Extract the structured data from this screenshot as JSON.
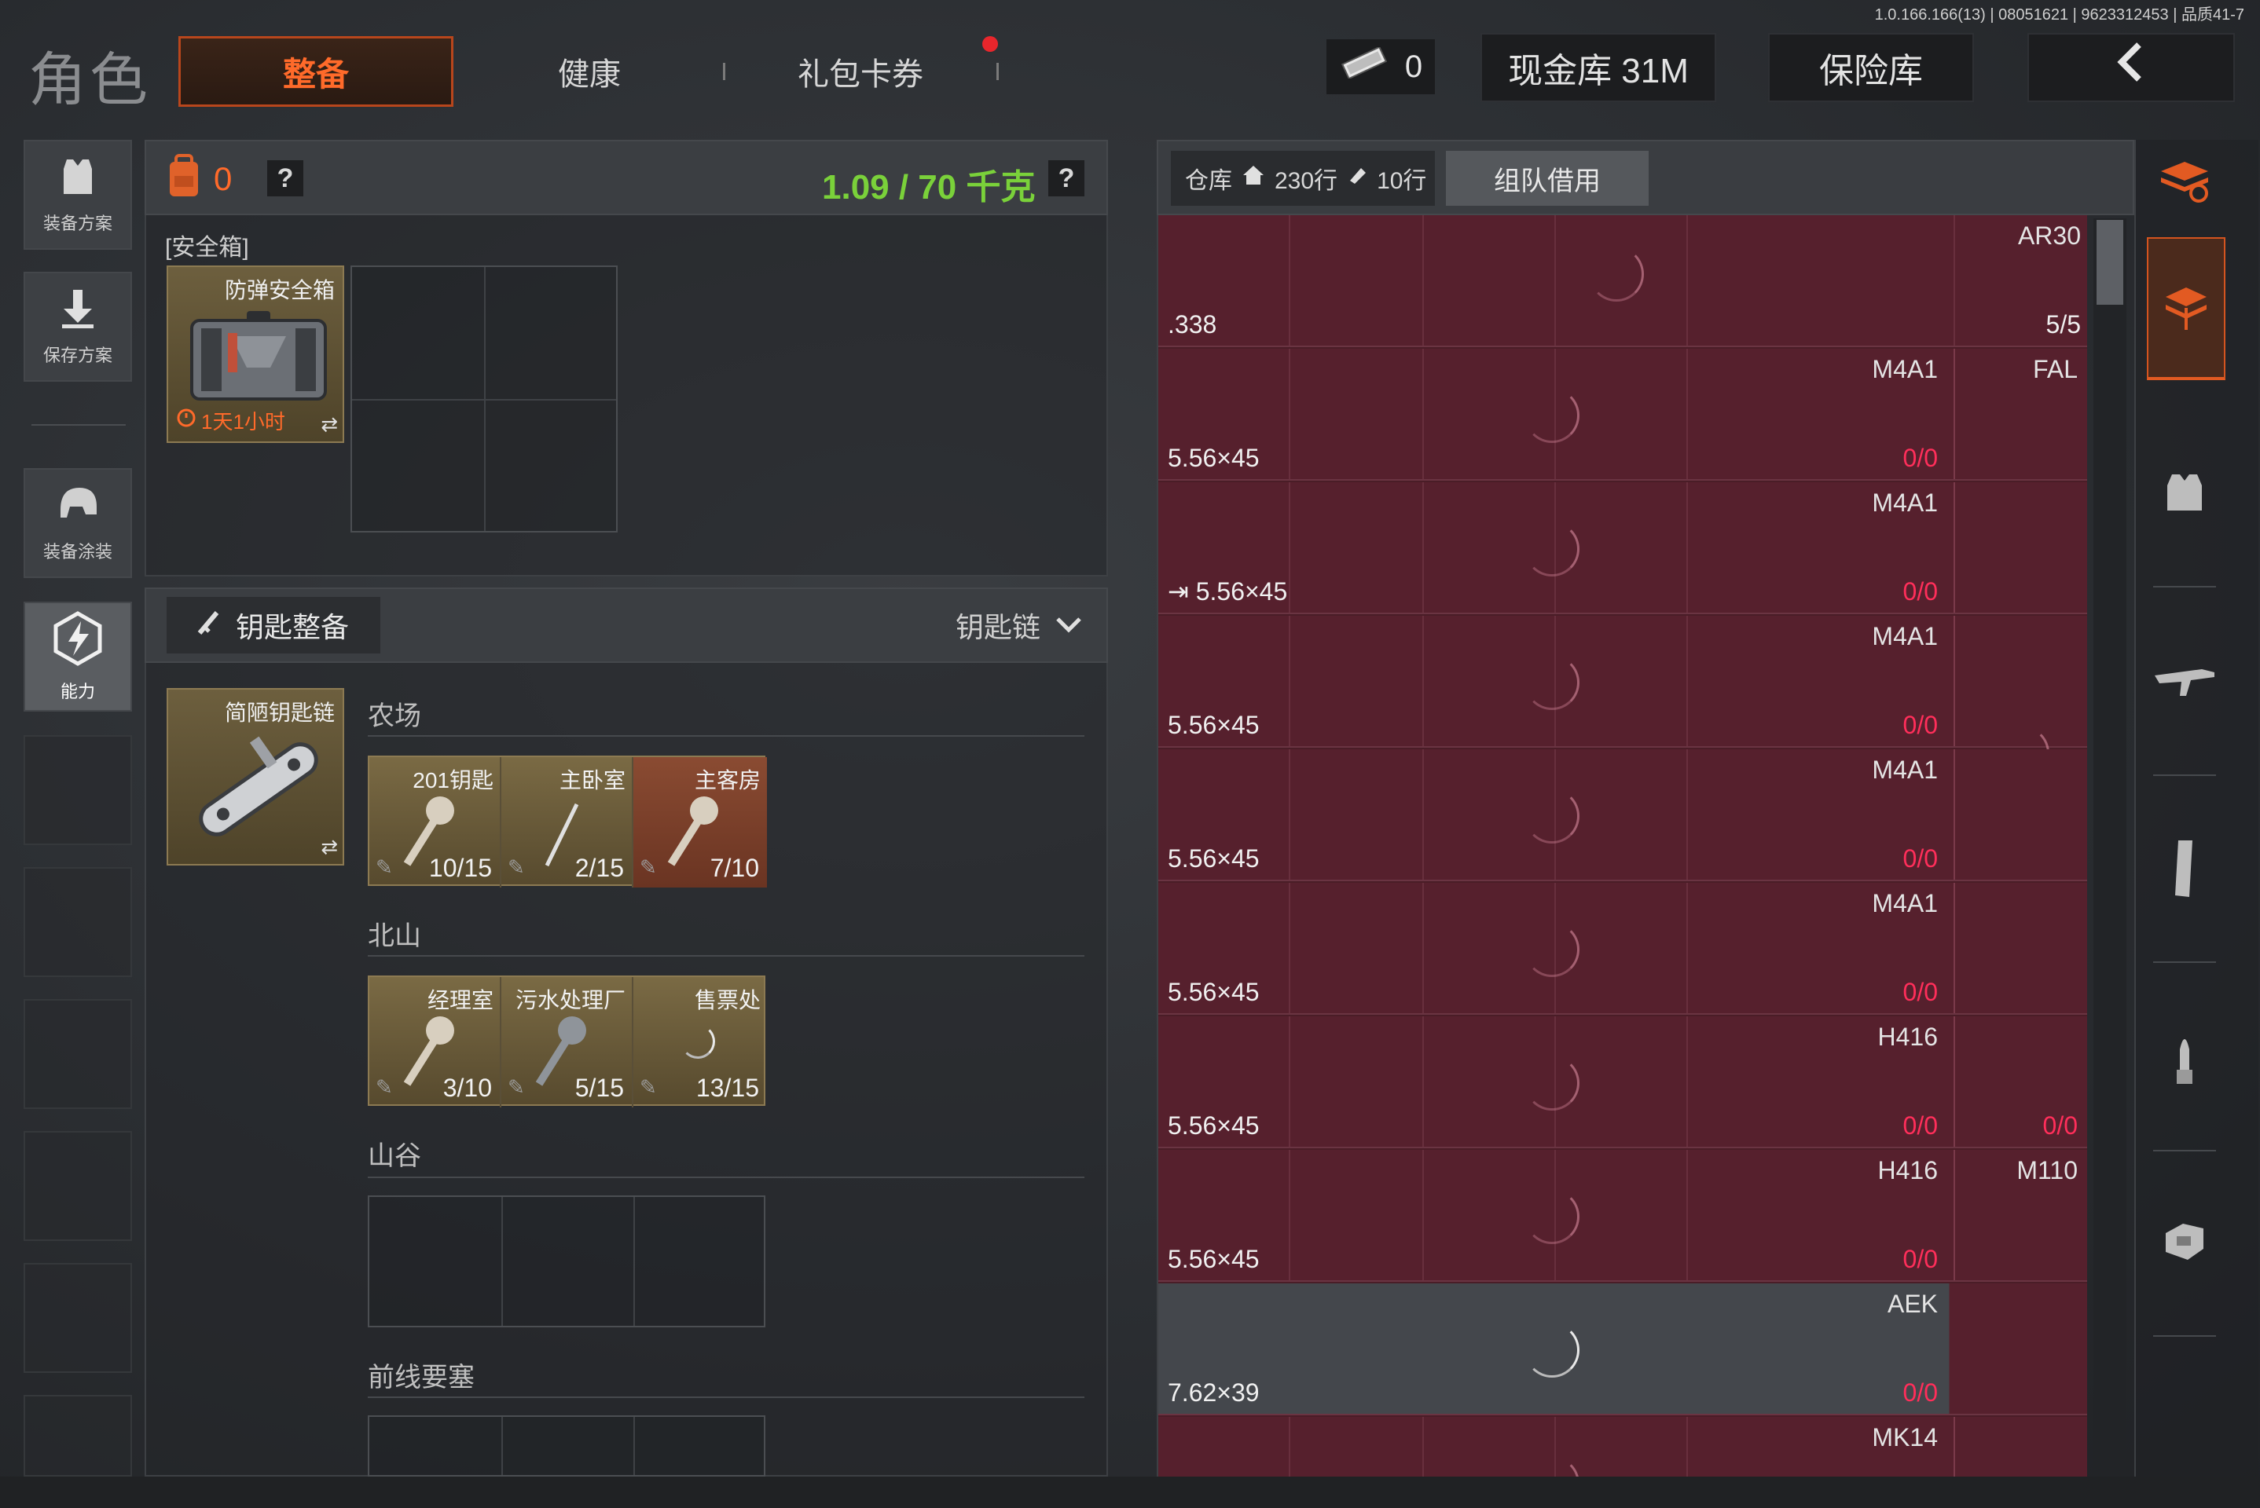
{
  "version": "1.0.166.166(13) | 08051621 | 9623312453 | 品质41-7",
  "header": {
    "title": "角色",
    "tabs": [
      {
        "label": "整备",
        "active": true
      },
      {
        "label": "健康",
        "active": false
      },
      {
        "label": "礼包卡券",
        "active": false
      }
    ],
    "money_value": "0",
    "cash_button": "现金库 31M",
    "safe_button": "保险库",
    "back_icon": "‹",
    "accent_color": "#ff6a2a"
  },
  "sidebar": {
    "items": [
      {
        "label": "装备方案",
        "icon": "armor-vest-icon"
      },
      {
        "label": "保存方案",
        "icon": "download-icon"
      },
      {
        "label": "装备涂装",
        "icon": "helmet-icon"
      },
      {
        "label": "能力",
        "icon": "ability-icon",
        "active": true
      }
    ]
  },
  "loadout": {
    "backpack_count": "0",
    "help": "?",
    "weight": "1.09 / 70 千克",
    "weight_color": "#7ad13a",
    "safe_box_label": "[安全箱]",
    "safe_box_item": {
      "name": "防弹安全箱",
      "timer": "1天1小时"
    }
  },
  "keys": {
    "title": "钥匙整备",
    "dropdown": "钥匙链",
    "keychain_item": "简陋钥匙链",
    "sections": [
      {
        "name": "农场",
        "keys": [
          {
            "name": "201钥匙",
            "count": "10/15"
          },
          {
            "name": "主卧室",
            "count": "2/15"
          },
          {
            "name": "主客房",
            "count": "7/10"
          }
        ]
      },
      {
        "name": "北山",
        "keys": [
          {
            "name": "经理室",
            "count": "3/10"
          },
          {
            "name": "污水处理厂",
            "count": "5/15"
          },
          {
            "name": "售票处",
            "count": "13/15"
          }
        ]
      },
      {
        "name": "山谷",
        "keys": []
      },
      {
        "name": "前线要塞",
        "keys": []
      }
    ]
  },
  "storage": {
    "warehouse_label": "仓库",
    "home_rows": "230行",
    "ticket_rows": "10行",
    "team_tab": "组队借用",
    "rows": [
      {
        "caliber": ".338",
        "name": "AR30",
        "ammo": "5/5",
        "right_name": "",
        "right_ammo": ""
      },
      {
        "caliber": "5.56×45",
        "name": "M4A1",
        "ammo": "0/0",
        "right_name": "FAL",
        "right_ammo": ""
      },
      {
        "caliber": "5.56×45",
        "name": "M4A1",
        "ammo": "0/0",
        "right_name": "",
        "right_ammo": ""
      },
      {
        "caliber": "5.56×45",
        "name": "M4A1",
        "ammo": "0/0",
        "right_name": "",
        "right_ammo": ""
      },
      {
        "caliber": "5.56×45",
        "name": "M4A1",
        "ammo": "0/0",
        "right_name": "",
        "right_ammo": ""
      },
      {
        "caliber": "5.56×45",
        "name": "M4A1",
        "ammo": "0/0",
        "right_name": "",
        "right_ammo": ""
      },
      {
        "caliber": "5.56×45",
        "name": "H416",
        "ammo": "0/0",
        "right_name": "",
        "right_ammo": "0/0"
      },
      {
        "caliber": "5.56×45",
        "name": "H416",
        "ammo": "0/0",
        "right_name": "M110",
        "right_ammo": ""
      },
      {
        "caliber": "7.62×39",
        "name": "AEK",
        "ammo": "0/0",
        "right_name": "",
        "right_ammo": ""
      },
      {
        "caliber": "",
        "name": "MK14",
        "ammo": "",
        "right_name": "",
        "right_ammo": ""
      }
    ],
    "ammo_zero_color": "#ff2e5a"
  },
  "filters": [
    "stack-refresh-icon",
    "inventory-icon",
    "armor-icon",
    "rifle-icon",
    "magazine-icon",
    "ammo-icon",
    "vest-icon"
  ]
}
